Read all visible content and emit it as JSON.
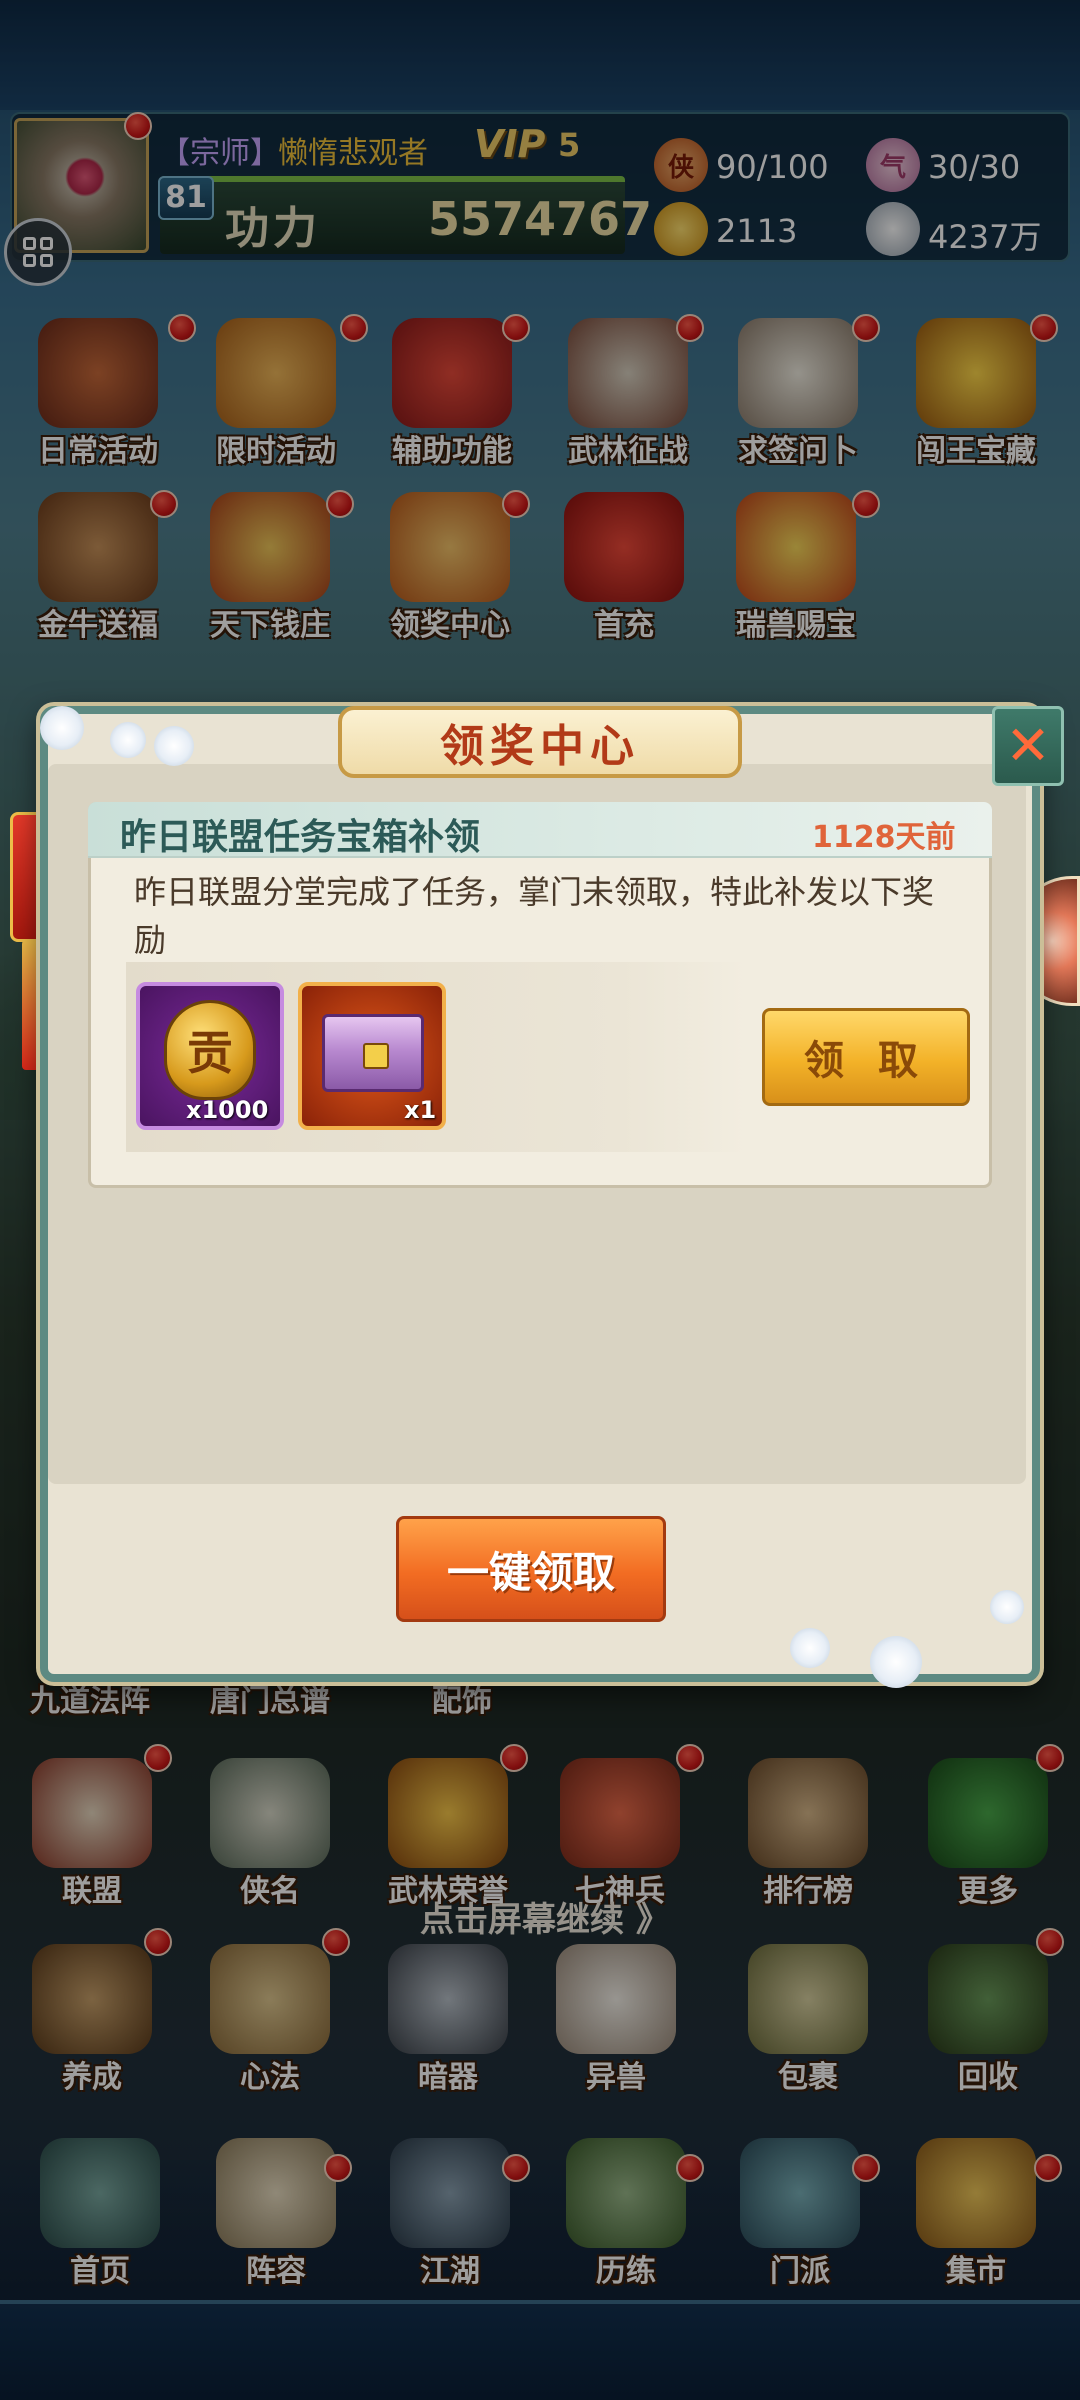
{
  "player": {
    "rank": "【宗师】",
    "name": "懒惰悲观者",
    "vip_label": "VIP",
    "vip_level": "5",
    "level": "81",
    "power_label": "功力",
    "power_value": "5574767"
  },
  "resources": {
    "stamina": {
      "icon": "侠",
      "value": "90/100"
    },
    "qi": {
      "icon": "气",
      "value": "30/30"
    },
    "gold": {
      "value": "2113"
    },
    "silver": {
      "value": "4237万"
    }
  },
  "activity_icons": [
    {
      "label": "日常活动",
      "icon": "daily-activity-icon"
    },
    {
      "label": "限时活动",
      "icon": "limited-activity-icon"
    },
    {
      "label": "辅助功能",
      "icon": "assist-function-icon"
    },
    {
      "label": "武林征战",
      "icon": "martial-battle-icon"
    },
    {
      "label": "求签问卜",
      "icon": "fortune-icon"
    },
    {
      "label": "闯王宝藏",
      "icon": "treasure-icon"
    },
    {
      "label": "金牛送福",
      "icon": "golden-ox-icon"
    },
    {
      "label": "天下钱庄",
      "icon": "bank-icon"
    },
    {
      "label": "领奖中心",
      "icon": "reward-center-icon"
    },
    {
      "label": "首充",
      "icon": "first-recharge-icon"
    },
    {
      "label": "瑞兽赐宝",
      "icon": "auspicious-beast-icon"
    }
  ],
  "dialog": {
    "title": "领奖中心",
    "card": {
      "title": "昨日联盟任务宝箱补领",
      "time": "1128天前",
      "description": "昨日联盟分堂完成了任务，掌门未领取，特此补发以下奖励",
      "rewards": [
        {
          "icon": "contribution-coin-icon",
          "glyph": "贡",
          "quantity": "x1000"
        },
        {
          "icon": "purple-chest-icon",
          "quantity": "x1"
        }
      ],
      "claim_label": "领 取"
    },
    "claim_all_label": "一键领取"
  },
  "partially_hidden_labels": [
    "九道法阵",
    "唐门总谱",
    "配饰"
  ],
  "menu_row_1": [
    "联盟",
    "侠名",
    "武林荣誉",
    "七神兵",
    "排行榜",
    "更多"
  ],
  "menu_row_2": [
    "养成",
    "心法",
    "暗器",
    "异兽",
    "包裹",
    "回收"
  ],
  "bottom_nav": [
    "首页",
    "阵容",
    "江湖",
    "历练",
    "门派",
    "集市"
  ],
  "continue_hint": "点击屏幕继续 》",
  "colors": {
    "dialog_border": "#5d8a82",
    "title_red": "#b23a18",
    "time_orange": "#e0643a",
    "claim_gold": "#f3b228",
    "claim_all_orange": "#f26c22"
  }
}
